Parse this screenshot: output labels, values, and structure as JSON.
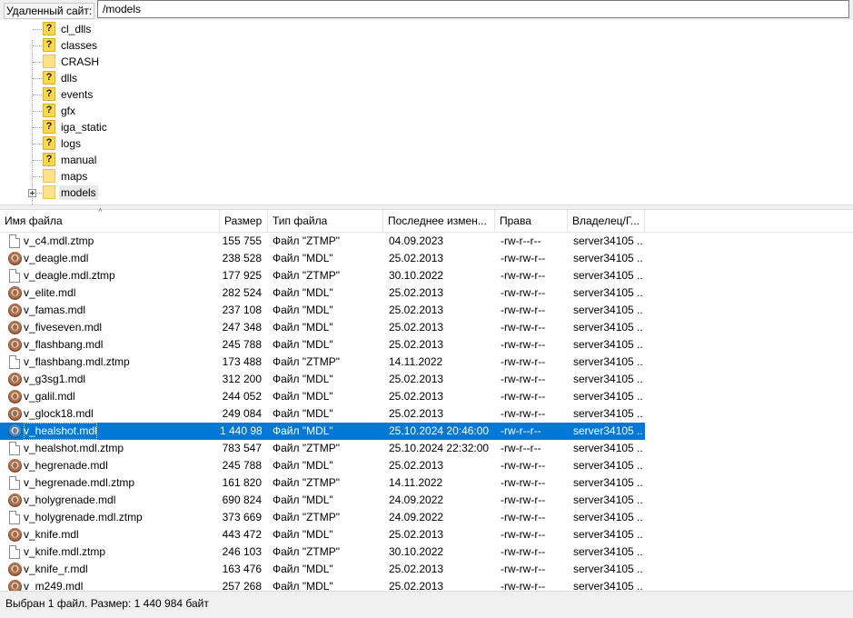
{
  "remote_path": {
    "label": "Удаленный сайт:",
    "value": "/models"
  },
  "tree": {
    "items": [
      {
        "label": "cl_dlls",
        "icon": "question-folder-icon"
      },
      {
        "label": "classes",
        "icon": "question-folder-icon"
      },
      {
        "label": "CRASH",
        "icon": "folder-icon"
      },
      {
        "label": "dlls",
        "icon": "question-folder-icon"
      },
      {
        "label": "events",
        "icon": "question-folder-icon"
      },
      {
        "label": "gfx",
        "icon": "question-folder-icon"
      },
      {
        "label": "iga_static",
        "icon": "question-folder-icon"
      },
      {
        "label": "logs",
        "icon": "question-folder-icon"
      },
      {
        "label": "manual",
        "icon": "question-folder-icon"
      },
      {
        "label": "maps",
        "icon": "folder-icon"
      },
      {
        "label": "models",
        "icon": "folder-icon",
        "selected": true,
        "expandable": true
      }
    ]
  },
  "columns": {
    "name": "Имя файла",
    "size": "Размер",
    "type": "Тип файла",
    "modified": "Последнее измен...",
    "perms": "Права",
    "owner": "Владелец/Г..."
  },
  "files": [
    {
      "name": "v_c4.mdl.ztmp",
      "size": "155 755",
      "type": "Файл \"ZTMP\"",
      "modified": "04.09.2023",
      "perms": "-rw-r--r--",
      "owner": "server34105 ..",
      "icon": "file-icon"
    },
    {
      "name": "v_deagle.mdl",
      "size": "238 528",
      "type": "Файл \"MDL\"",
      "modified": "25.02.2013",
      "perms": "-rw-rw-r--",
      "owner": "server34105 ..",
      "icon": "mdl-icon"
    },
    {
      "name": "v_deagle.mdl.ztmp",
      "size": "177 925",
      "type": "Файл \"ZTMP\"",
      "modified": "30.10.2022",
      "perms": "-rw-rw-r--",
      "owner": "server34105 ..",
      "icon": "file-icon"
    },
    {
      "name": "v_elite.mdl",
      "size": "282 524",
      "type": "Файл \"MDL\"",
      "modified": "25.02.2013",
      "perms": "-rw-rw-r--",
      "owner": "server34105 ..",
      "icon": "mdl-icon"
    },
    {
      "name": "v_famas.mdl",
      "size": "237 108",
      "type": "Файл \"MDL\"",
      "modified": "25.02.2013",
      "perms": "-rw-rw-r--",
      "owner": "server34105 ..",
      "icon": "mdl-icon"
    },
    {
      "name": "v_fiveseven.mdl",
      "size": "247 348",
      "type": "Файл \"MDL\"",
      "modified": "25.02.2013",
      "perms": "-rw-rw-r--",
      "owner": "server34105 ..",
      "icon": "mdl-icon"
    },
    {
      "name": "v_flashbang.mdl",
      "size": "245 788",
      "type": "Файл \"MDL\"",
      "modified": "25.02.2013",
      "perms": "-rw-rw-r--",
      "owner": "server34105 ..",
      "icon": "mdl-icon"
    },
    {
      "name": "v_flashbang.mdl.ztmp",
      "size": "173 488",
      "type": "Файл \"ZTMP\"",
      "modified": "14.11.2022",
      "perms": "-rw-rw-r--",
      "owner": "server34105 ..",
      "icon": "file-icon"
    },
    {
      "name": "v_g3sg1.mdl",
      "size": "312 200",
      "type": "Файл \"MDL\"",
      "modified": "25.02.2013",
      "perms": "-rw-rw-r--",
      "owner": "server34105 ..",
      "icon": "mdl-icon"
    },
    {
      "name": "v_galil.mdl",
      "size": "244 052",
      "type": "Файл \"MDL\"",
      "modified": "25.02.2013",
      "perms": "-rw-rw-r--",
      "owner": "server34105 ..",
      "icon": "mdl-icon"
    },
    {
      "name": "v_glock18.mdl",
      "size": "249 084",
      "type": "Файл \"MDL\"",
      "modified": "25.02.2013",
      "perms": "-rw-rw-r--",
      "owner": "server34105 ..",
      "icon": "mdl-icon"
    },
    {
      "name": "v_healshot.mdl",
      "size": "1 440 984",
      "type": "Файл \"MDL\"",
      "modified": "25.10.2024 20:46:00",
      "perms": "-rw-r--r--",
      "owner": "server34105 ..",
      "icon": "mdl-icon",
      "selected": true
    },
    {
      "name": "v_healshot.mdl.ztmp",
      "size": "783 547",
      "type": "Файл \"ZTMP\"",
      "modified": "25.10.2024 22:32:00",
      "perms": "-rw-r--r--",
      "owner": "server34105 ..",
      "icon": "file-icon"
    },
    {
      "name": "v_hegrenade.mdl",
      "size": "245 788",
      "type": "Файл \"MDL\"",
      "modified": "25.02.2013",
      "perms": "-rw-rw-r--",
      "owner": "server34105 ..",
      "icon": "mdl-icon"
    },
    {
      "name": "v_hegrenade.mdl.ztmp",
      "size": "161 820",
      "type": "Файл \"ZTMP\"",
      "modified": "14.11.2022",
      "perms": "-rw-rw-r--",
      "owner": "server34105 ..",
      "icon": "file-icon"
    },
    {
      "name": "v_holygrenade.mdl",
      "size": "690 824",
      "type": "Файл \"MDL\"",
      "modified": "24.09.2022",
      "perms": "-rw-rw-r--",
      "owner": "server34105 ..",
      "icon": "mdl-icon"
    },
    {
      "name": "v_holygrenade.mdl.ztmp",
      "size": "373 669",
      "type": "Файл \"ZTMP\"",
      "modified": "24.09.2022",
      "perms": "-rw-rw-r--",
      "owner": "server34105 ..",
      "icon": "file-icon"
    },
    {
      "name": "v_knife.mdl",
      "size": "443 472",
      "type": "Файл \"MDL\"",
      "modified": "25.02.2013",
      "perms": "-rw-rw-r--",
      "owner": "server34105 ..",
      "icon": "mdl-icon"
    },
    {
      "name": "v_knife.mdl.ztmp",
      "size": "246 103",
      "type": "Файл \"ZTMP\"",
      "modified": "30.10.2022",
      "perms": "-rw-rw-r--",
      "owner": "server34105 ..",
      "icon": "file-icon"
    },
    {
      "name": "v_knife_r.mdl",
      "size": "163 476",
      "type": "Файл \"MDL\"",
      "modified": "25.02.2013",
      "perms": "-rw-rw-r--",
      "owner": "server34105 ..",
      "icon": "mdl-icon"
    },
    {
      "name": "v_m249.mdl",
      "size": "257 268",
      "type": "Файл \"MDL\"",
      "modified": "25.02.2013",
      "perms": "-rw-rw-r--",
      "owner": "server34105 ..",
      "icon": "mdl-icon"
    }
  ],
  "status": {
    "text": "Выбран 1 файл. Размер: 1 440 984 байт"
  },
  "colors": {
    "selection": "#0078d7",
    "folder": "#ffe28a",
    "unknown_folder": "#ffd84a"
  }
}
